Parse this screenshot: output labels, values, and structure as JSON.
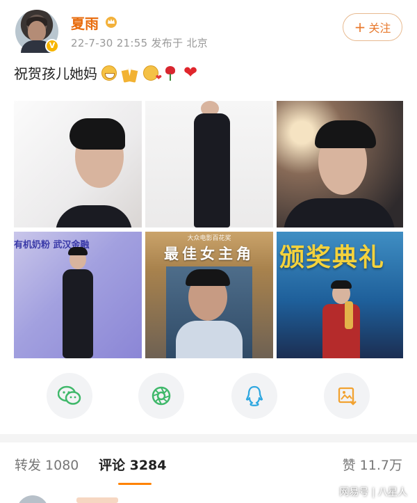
{
  "post": {
    "username": "夏雨",
    "meta": "22-7-30 21:55  发布于 北京",
    "follow_label": "关注",
    "text": "祝贺孩儿她妈"
  },
  "photos": {
    "p5_small": "大众电影百花奖",
    "p5_title": "最佳女主角",
    "p6_title": "颁奖典礼",
    "p4_wall_1": "有机奶粉   武汉金融",
    "p4_wall_2": "武汉金融"
  },
  "share": {
    "wechat": "wechat-icon",
    "moments": "moments-icon",
    "qq": "qq-icon",
    "save": "save-image-icon"
  },
  "tabs": {
    "forward": "转发 1080",
    "comment": "评论 3284",
    "like": "赞 11.7万"
  },
  "watermark": "网易号 | 八星人",
  "colors": {
    "accent": "#ff8200",
    "username": "#e86b0c"
  }
}
